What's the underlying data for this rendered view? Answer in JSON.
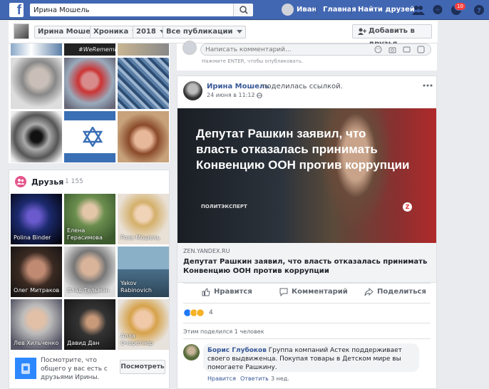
{
  "topbar": {
    "logo": "f",
    "search_value": "Ирина Мошель",
    "user_name": "Иван",
    "home_label": "Главная",
    "find_friends_label": "Найти друзей",
    "notif_count": "10"
  },
  "timeline_bar": {
    "profile_name": "Ирина Мошель",
    "chronicle_label": "Хроника",
    "year": "2018",
    "filter": "Все публикации",
    "add_friend_label": "Добавить в друзья"
  },
  "photos": {
    "top_strip_text": "#WeRemember"
  },
  "friends": {
    "title": "Друзья",
    "count": "1 155",
    "items": [
      {
        "name": "Polina Binder"
      },
      {
        "name": "Елена Герасимова"
      },
      {
        "name": "Роза Мошель"
      },
      {
        "name": "Олег Митраков"
      },
      {
        "name": "Влад Тельман"
      },
      {
        "name": "Yakov Rabinovich"
      },
      {
        "name": "Лев Хильченко"
      },
      {
        "name": "Давид Дан"
      },
      {
        "name": "Алла Очеретнер"
      }
    ],
    "prompt": "Посмотрите, что общего у вас есть с друзьями Ирины.",
    "see_button": "Посмотреть"
  },
  "comment_box": {
    "placeholder": "Написать комментарий...",
    "hint": "Нажмите ENTER, чтобы опубликовать."
  },
  "post": {
    "author": "Ирина Мошель",
    "action": "поделилась ссылкой.",
    "time": "24 июня в 11:12",
    "separator": "·",
    "image_headline": "Депутат Рашкин заявил, что власть отказалась принимать Конвенцию ООН против коррупции",
    "image_source": "ПОЛИТЭКСПЕРТ",
    "image_badge": "Z",
    "link_domain": "ZEN.YANDEX.RU",
    "link_title": "Депутат Рашкин заявил, что власть отказалась принимать Конвенцию ООН против коррупции",
    "like_label": "Нравится",
    "comment_label": "Комментарий",
    "share_label": "Поделиться",
    "reactions_count": "4",
    "shared_text": "Этим поделился 1 человек",
    "comment": {
      "author": "Борис Глубоков",
      "text": "Группа компаний Астек поддерживает своего выдвиженца. Покупая товары в Детском мире вы помогаете Рашкину.",
      "like": "Нравится",
      "reply": "Ответить",
      "dot": "·",
      "time": "3 нед."
    }
  },
  "colors": {
    "brand_blue": "#4267b2",
    "link_blue": "#385898",
    "background": "#e9ebee",
    "notif_red": "#fa3e3e"
  }
}
